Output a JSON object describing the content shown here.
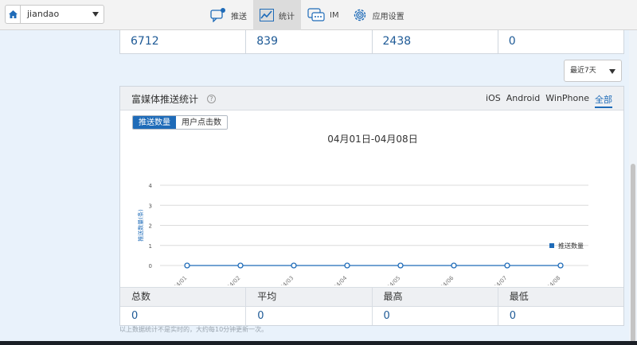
{
  "topbar": {
    "app_name": "jiandao",
    "nav": [
      {
        "label": "推送",
        "icon": "push-bubble-icon"
      },
      {
        "label": "统计",
        "icon": "stats-chart-icon",
        "active": true
      },
      {
        "label": "IM",
        "icon": "im-chat-icon"
      },
      {
        "label": "应用设置",
        "icon": "gear-icon"
      }
    ]
  },
  "summary_top": {
    "values": [
      "6712",
      "839",
      "2438",
      "0"
    ]
  },
  "range_select": {
    "value": "最近7天"
  },
  "panel": {
    "title": "富媒体推送统计",
    "help": "?",
    "platforms": [
      "iOS",
      "Android",
      "WinPhone",
      "全部"
    ],
    "active_platform": "全部",
    "toggle": {
      "on": "推送数量",
      "off": "用户点击数"
    }
  },
  "chart_data": {
    "type": "line",
    "title": "04月01日-04月08日",
    "ylabel": "推送数量(条)",
    "x": [
      "04/01",
      "04/02",
      "04/03",
      "04/04",
      "04/05",
      "04/06",
      "04/07",
      "04/08"
    ],
    "series": [
      {
        "name": "推送数量",
        "values": [
          0,
          0,
          0,
          0,
          0,
          0,
          0,
          0
        ]
      }
    ],
    "yticks": [
      "0",
      "1",
      "2",
      "3",
      "4"
    ],
    "ylim": [
      0,
      4
    ],
    "grid": true,
    "legend": "bottom-right",
    "color": "#1e6bb8"
  },
  "stats": {
    "labels": [
      "总数",
      "平均",
      "最高",
      "最低"
    ],
    "values": [
      "0",
      "0",
      "0",
      "0"
    ]
  },
  "note": "以上数据统计不是实时的，大约每10分钟更新一次。"
}
